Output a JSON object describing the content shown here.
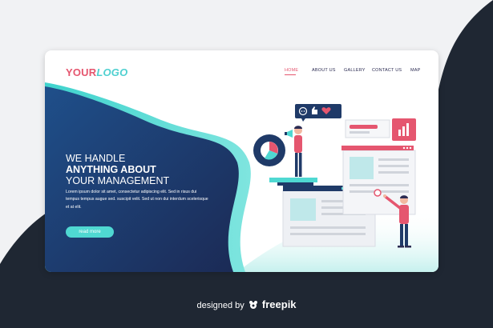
{
  "logo": {
    "part1": "YOUR",
    "part2": "LOGO"
  },
  "nav": {
    "items": [
      {
        "label": "HOME",
        "active": true
      },
      {
        "label": "ABOUT US",
        "active": false
      },
      {
        "label": "GALLERY",
        "active": false
      },
      {
        "label": "CONTACT US",
        "active": false
      },
      {
        "label": "MAP",
        "active": false
      }
    ]
  },
  "hero": {
    "line1": "WE HANDLE",
    "line2": "ANYTHING ABOUT",
    "line3": "YOUR MANAGEMENT",
    "body": "Lorem ipsum dolor sit amet, consectetur adipiscing elit. Sed in risus dui tempus tempus augue sed. suscipit velit. Sed ut non dui interdum scelerisque et at elit.",
    "button_label": "read more"
  },
  "footer": {
    "prefix": "designed by",
    "brand": "freepik"
  },
  "colors": {
    "accent_pink": "#e5566f",
    "accent_teal": "#4fd8d2",
    "navy": "#1f3a68",
    "dark_bg": "#1f2733"
  },
  "icons": [
    "megaphone-icon",
    "pie-chart-icon",
    "chat-icon",
    "like-icon",
    "heart-icon",
    "bar-chart-icon",
    "freepik-icon"
  ]
}
